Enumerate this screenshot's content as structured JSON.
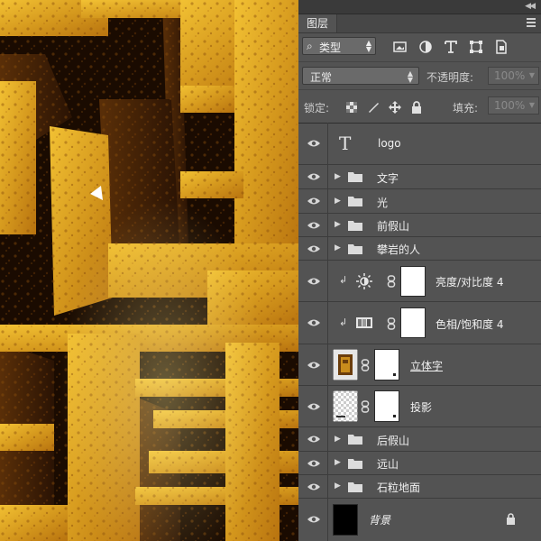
{
  "panel": {
    "title": "图层",
    "filter": {
      "label": "类型"
    },
    "filter_icons": [
      "image-filter-icon",
      "adjustment-filter-icon",
      "type-filter-icon",
      "shape-filter-icon",
      "smart-object-filter-icon"
    ],
    "blend_mode": "正常",
    "opacity_label": "不透明度:",
    "opacity_value": "100%",
    "lock_label": "锁定:",
    "fill_label": "填充:",
    "fill_value": "100%"
  },
  "layers": [
    {
      "name": "logo",
      "kind": "text"
    },
    {
      "name": "文字",
      "kind": "group"
    },
    {
      "name": "光",
      "kind": "group"
    },
    {
      "name": "前假山",
      "kind": "group"
    },
    {
      "name": "攀岩的人",
      "kind": "group"
    },
    {
      "name": "亮度/对比度 4",
      "kind": "adjustment-brightness",
      "clipped": true
    },
    {
      "name": "色相/饱和度 4",
      "kind": "adjustment-hue",
      "clipped": true
    },
    {
      "name": "立体字",
      "kind": "smart-masked"
    },
    {
      "name": "投影",
      "kind": "masked"
    },
    {
      "name": "后假山",
      "kind": "group"
    },
    {
      "name": "远山",
      "kind": "group"
    },
    {
      "name": "石粒地面",
      "kind": "group"
    },
    {
      "name": "背景",
      "kind": "background",
      "locked": true
    }
  ]
}
